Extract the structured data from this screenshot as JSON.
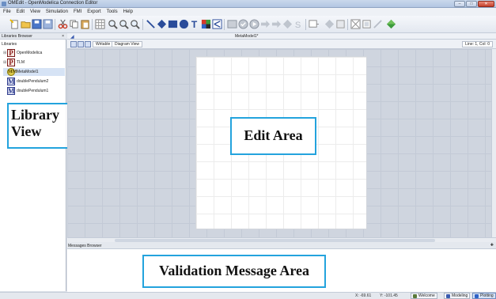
{
  "window": {
    "title": "OMEdit - OpenModelica Connection Editor"
  },
  "menu": [
    "File",
    "Edit",
    "View",
    "Simulation",
    "FMI",
    "Export",
    "Tools",
    "Help"
  ],
  "toolbar_icons": [
    "new-file-icon",
    "open-folder-icon",
    "save-icon",
    "save-all-icon",
    "cut-icon",
    "copy-icon",
    "paste-icon",
    "grid-icon",
    "zoom-in-icon",
    "zoom-out-icon",
    "zoom-reset-icon",
    "line-tool-icon",
    "polygon-tool-icon",
    "rectangle-tool-icon",
    "ellipse-tool-icon",
    "text-tool-icon",
    "bitmap-tool-icon",
    "connect-mode-icon",
    "check-model-icon",
    "simulate-icon",
    "simulation-setup-icon",
    "export-fmu-icon",
    "import-fmu-icon",
    "interactive-simulate-icon",
    "pause-icon",
    "plot-window-icon",
    "parametric-plot-icon",
    "clear-plot-icon",
    "array-plot-icon",
    "diff-icon",
    "run-icon"
  ],
  "libraries_browser": {
    "title": "Libraries Browser",
    "close": "×",
    "root": "Libraries",
    "items": [
      {
        "label": "OpenModelica",
        "icon": "P",
        "expandable": true
      },
      {
        "label": "TLM",
        "icon": "P",
        "expandable": true
      },
      {
        "label": "MetaModel1",
        "icon": "MM",
        "expandable": false
      },
      {
        "label": "doublePendulum2",
        "icon": "M",
        "expandable": false
      },
      {
        "label": "doublePendulum1",
        "icon": "M",
        "expandable": false
      }
    ]
  },
  "library_view_label": [
    "Library",
    "View"
  ],
  "document": {
    "tab_title": "MetaModel1*",
    "view_buttons": [
      "Writable",
      "Diagram View"
    ],
    "line_col": "Line: 1, Col: 0"
  },
  "edit_area_label": "Edit Area",
  "messages_browser": {
    "title": "Messages Browser"
  },
  "validation_label": "Validation Message Area",
  "status": {
    "x": "X: -69.61",
    "y": "Y: -101.45",
    "perspectives": [
      "Welcome",
      "Modeling",
      "Plotting"
    ]
  },
  "colors": {
    "annotation_border": "#23a3dd",
    "selected_perspective": "#d6e3f5"
  }
}
